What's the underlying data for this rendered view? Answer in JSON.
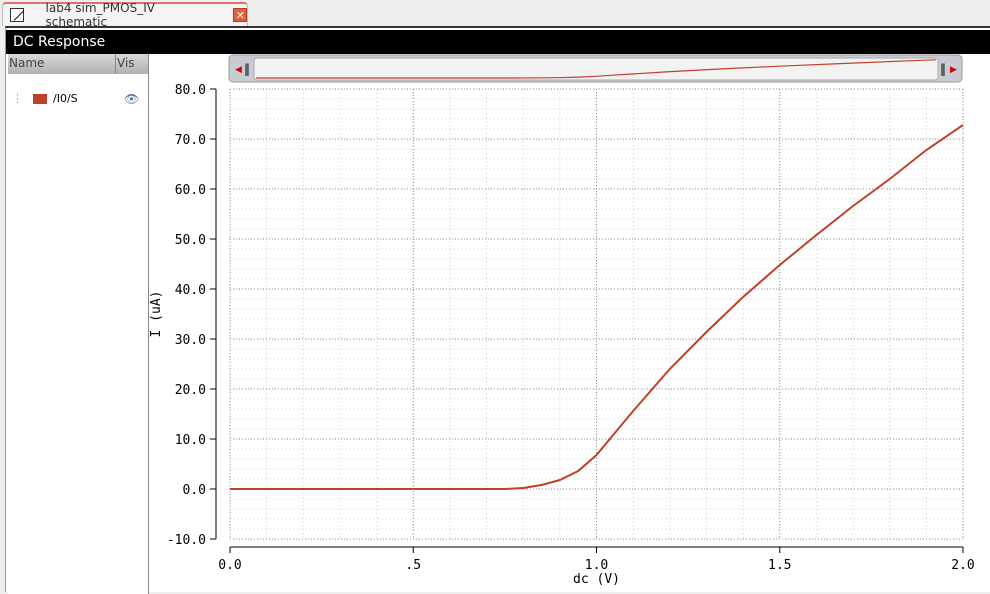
{
  "tab": {
    "title": "lab4 sim_PMOS_IV schematic",
    "close": "✕"
  },
  "window": {
    "title": "DC Response"
  },
  "legend": {
    "headers": [
      "Name",
      "Vis"
    ],
    "items": [
      {
        "name": "/I0/S",
        "color": "#c0402a",
        "visible": true
      }
    ]
  },
  "chart_data": {
    "type": "line",
    "title": "DC Response",
    "xlabel": "dc (V)",
    "ylabel": "I (uA)",
    "xlim": [
      0,
      2.0
    ],
    "ylim": [
      -10,
      80
    ],
    "xticks": [
      0,
      0.5,
      1.0,
      1.5,
      2.0
    ],
    "xtick_labels": [
      "0.0",
      ".5",
      "1.0",
      "1.5",
      "2.0"
    ],
    "yticks": [
      -10,
      0,
      10,
      20,
      30,
      40,
      50,
      60,
      70,
      80
    ],
    "ytick_labels": [
      "-10.0",
      "0.0",
      "10.0",
      "20.0",
      "30.0",
      "40.0",
      "50.0",
      "60.0",
      "70.0",
      "80.0"
    ],
    "grid": true,
    "series": [
      {
        "name": "/I0/S",
        "color": "#c0402a",
        "x": [
          0,
          0.5,
          0.75,
          0.8,
          0.85,
          0.9,
          0.95,
          1.0,
          1.05,
          1.1,
          1.2,
          1.3,
          1.4,
          1.5,
          1.6,
          1.7,
          1.8,
          1.9,
          2.0
        ],
        "y": [
          0,
          0,
          0,
          0.2,
          0.8,
          1.8,
          3.6,
          6.8,
          11.2,
          15.6,
          24,
          31.4,
          38.4,
          44.8,
          50.8,
          56.6,
          62,
          67.8,
          72.8
        ]
      }
    ]
  }
}
